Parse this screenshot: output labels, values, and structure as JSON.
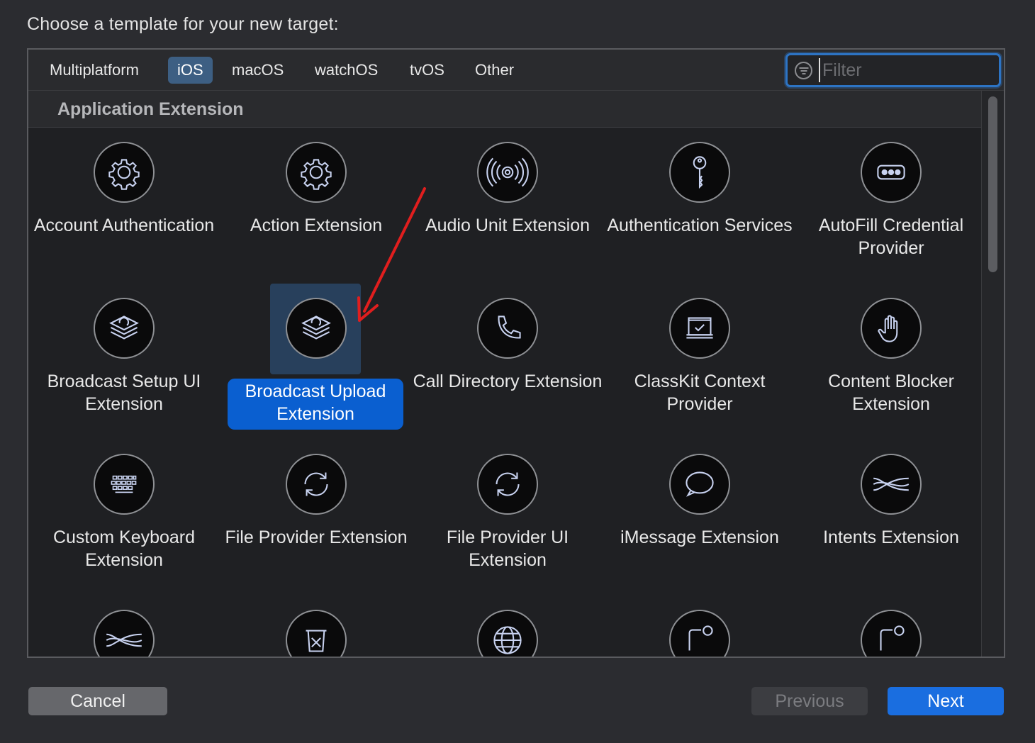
{
  "prompt": "Choose a template for your new target:",
  "tabs": [
    {
      "label": "Multiplatform",
      "active": false
    },
    {
      "label": "iOS",
      "active": true
    },
    {
      "label": "macOS",
      "active": false
    },
    {
      "label": "watchOS",
      "active": false
    },
    {
      "label": "tvOS",
      "active": false
    },
    {
      "label": "Other",
      "active": false
    }
  ],
  "filter": {
    "placeholder": "Filter",
    "value": ""
  },
  "section": {
    "title": "Application Extension"
  },
  "templates": [
    {
      "label": "Account Authentication",
      "icon": "gear-icon"
    },
    {
      "label": "Action Extension",
      "icon": "gear-icon"
    },
    {
      "label": "Audio Unit Extension",
      "icon": "audio-waves-icon"
    },
    {
      "label": "Authentication Services",
      "icon": "key-icon"
    },
    {
      "label": "AutoFill Credential Provider",
      "icon": "dots-icon"
    },
    {
      "label": "Broadcast Setup UI Extension",
      "icon": "broadcast-stack-icon"
    },
    {
      "label": "Broadcast Upload Extension",
      "icon": "broadcast-stack-icon",
      "selected": true
    },
    {
      "label": "Call Directory Extension",
      "icon": "phone-icon"
    },
    {
      "label": "ClassKit Context Provider",
      "icon": "classkit-icon"
    },
    {
      "label": "Content Blocker Extension",
      "icon": "hand-icon"
    },
    {
      "label": "Custom Keyboard Extension",
      "icon": "keyboard-icon"
    },
    {
      "label": "File Provider Extension",
      "icon": "sync-icon"
    },
    {
      "label": "File Provider UI Extension",
      "icon": "sync-icon"
    },
    {
      "label": "iMessage Extension",
      "icon": "speech-bubble-icon"
    },
    {
      "label": "Intents Extension",
      "icon": "waves-icon"
    }
  ],
  "partial_row_icons": [
    "waves-icon",
    "trash-icon",
    "globe-icon",
    "notification-icon",
    "notification-icon"
  ],
  "buttons": {
    "cancel": "Cancel",
    "previous": "Previous",
    "next": "Next"
  },
  "colors": {
    "accent": "#0a5fd0",
    "annotation_arrow": "#e01e1e"
  }
}
